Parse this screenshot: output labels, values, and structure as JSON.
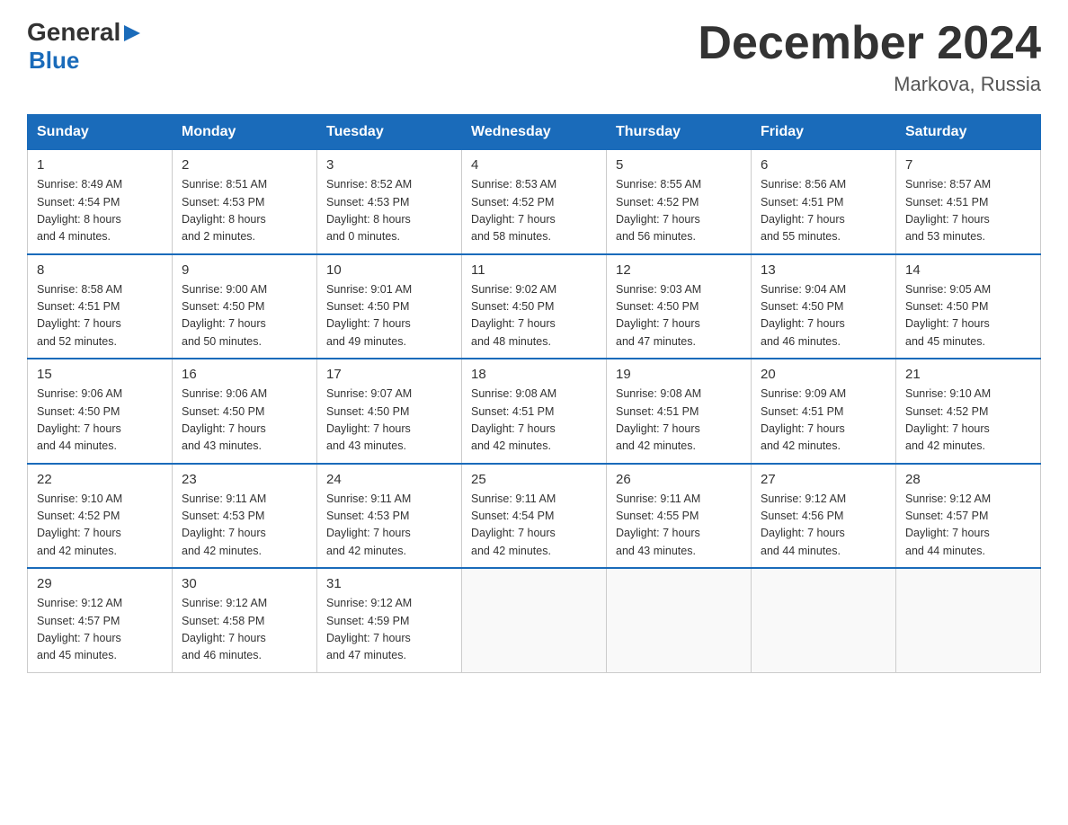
{
  "logo": {
    "general": "General",
    "blue": "Blue",
    "triangle": "▶"
  },
  "header": {
    "title": "December 2024",
    "location": "Markova, Russia"
  },
  "weekdays": [
    "Sunday",
    "Monday",
    "Tuesday",
    "Wednesday",
    "Thursday",
    "Friday",
    "Saturday"
  ],
  "weeks": [
    [
      {
        "day": "1",
        "info": "Sunrise: 8:49 AM\nSunset: 4:54 PM\nDaylight: 8 hours\nand 4 minutes."
      },
      {
        "day": "2",
        "info": "Sunrise: 8:51 AM\nSunset: 4:53 PM\nDaylight: 8 hours\nand 2 minutes."
      },
      {
        "day": "3",
        "info": "Sunrise: 8:52 AM\nSunset: 4:53 PM\nDaylight: 8 hours\nand 0 minutes."
      },
      {
        "day": "4",
        "info": "Sunrise: 8:53 AM\nSunset: 4:52 PM\nDaylight: 7 hours\nand 58 minutes."
      },
      {
        "day": "5",
        "info": "Sunrise: 8:55 AM\nSunset: 4:52 PM\nDaylight: 7 hours\nand 56 minutes."
      },
      {
        "day": "6",
        "info": "Sunrise: 8:56 AM\nSunset: 4:51 PM\nDaylight: 7 hours\nand 55 minutes."
      },
      {
        "day": "7",
        "info": "Sunrise: 8:57 AM\nSunset: 4:51 PM\nDaylight: 7 hours\nand 53 minutes."
      }
    ],
    [
      {
        "day": "8",
        "info": "Sunrise: 8:58 AM\nSunset: 4:51 PM\nDaylight: 7 hours\nand 52 minutes."
      },
      {
        "day": "9",
        "info": "Sunrise: 9:00 AM\nSunset: 4:50 PM\nDaylight: 7 hours\nand 50 minutes."
      },
      {
        "day": "10",
        "info": "Sunrise: 9:01 AM\nSunset: 4:50 PM\nDaylight: 7 hours\nand 49 minutes."
      },
      {
        "day": "11",
        "info": "Sunrise: 9:02 AM\nSunset: 4:50 PM\nDaylight: 7 hours\nand 48 minutes."
      },
      {
        "day": "12",
        "info": "Sunrise: 9:03 AM\nSunset: 4:50 PM\nDaylight: 7 hours\nand 47 minutes."
      },
      {
        "day": "13",
        "info": "Sunrise: 9:04 AM\nSunset: 4:50 PM\nDaylight: 7 hours\nand 46 minutes."
      },
      {
        "day": "14",
        "info": "Sunrise: 9:05 AM\nSunset: 4:50 PM\nDaylight: 7 hours\nand 45 minutes."
      }
    ],
    [
      {
        "day": "15",
        "info": "Sunrise: 9:06 AM\nSunset: 4:50 PM\nDaylight: 7 hours\nand 44 minutes."
      },
      {
        "day": "16",
        "info": "Sunrise: 9:06 AM\nSunset: 4:50 PM\nDaylight: 7 hours\nand 43 minutes."
      },
      {
        "day": "17",
        "info": "Sunrise: 9:07 AM\nSunset: 4:50 PM\nDaylight: 7 hours\nand 43 minutes."
      },
      {
        "day": "18",
        "info": "Sunrise: 9:08 AM\nSunset: 4:51 PM\nDaylight: 7 hours\nand 42 minutes."
      },
      {
        "day": "19",
        "info": "Sunrise: 9:08 AM\nSunset: 4:51 PM\nDaylight: 7 hours\nand 42 minutes."
      },
      {
        "day": "20",
        "info": "Sunrise: 9:09 AM\nSunset: 4:51 PM\nDaylight: 7 hours\nand 42 minutes."
      },
      {
        "day": "21",
        "info": "Sunrise: 9:10 AM\nSunset: 4:52 PM\nDaylight: 7 hours\nand 42 minutes."
      }
    ],
    [
      {
        "day": "22",
        "info": "Sunrise: 9:10 AM\nSunset: 4:52 PM\nDaylight: 7 hours\nand 42 minutes."
      },
      {
        "day": "23",
        "info": "Sunrise: 9:11 AM\nSunset: 4:53 PM\nDaylight: 7 hours\nand 42 minutes."
      },
      {
        "day": "24",
        "info": "Sunrise: 9:11 AM\nSunset: 4:53 PM\nDaylight: 7 hours\nand 42 minutes."
      },
      {
        "day": "25",
        "info": "Sunrise: 9:11 AM\nSunset: 4:54 PM\nDaylight: 7 hours\nand 42 minutes."
      },
      {
        "day": "26",
        "info": "Sunrise: 9:11 AM\nSunset: 4:55 PM\nDaylight: 7 hours\nand 43 minutes."
      },
      {
        "day": "27",
        "info": "Sunrise: 9:12 AM\nSunset: 4:56 PM\nDaylight: 7 hours\nand 44 minutes."
      },
      {
        "day": "28",
        "info": "Sunrise: 9:12 AM\nSunset: 4:57 PM\nDaylight: 7 hours\nand 44 minutes."
      }
    ],
    [
      {
        "day": "29",
        "info": "Sunrise: 9:12 AM\nSunset: 4:57 PM\nDaylight: 7 hours\nand 45 minutes."
      },
      {
        "day": "30",
        "info": "Sunrise: 9:12 AM\nSunset: 4:58 PM\nDaylight: 7 hours\nand 46 minutes."
      },
      {
        "day": "31",
        "info": "Sunrise: 9:12 AM\nSunset: 4:59 PM\nDaylight: 7 hours\nand 47 minutes."
      },
      {
        "day": "",
        "info": ""
      },
      {
        "day": "",
        "info": ""
      },
      {
        "day": "",
        "info": ""
      },
      {
        "day": "",
        "info": ""
      }
    ]
  ]
}
